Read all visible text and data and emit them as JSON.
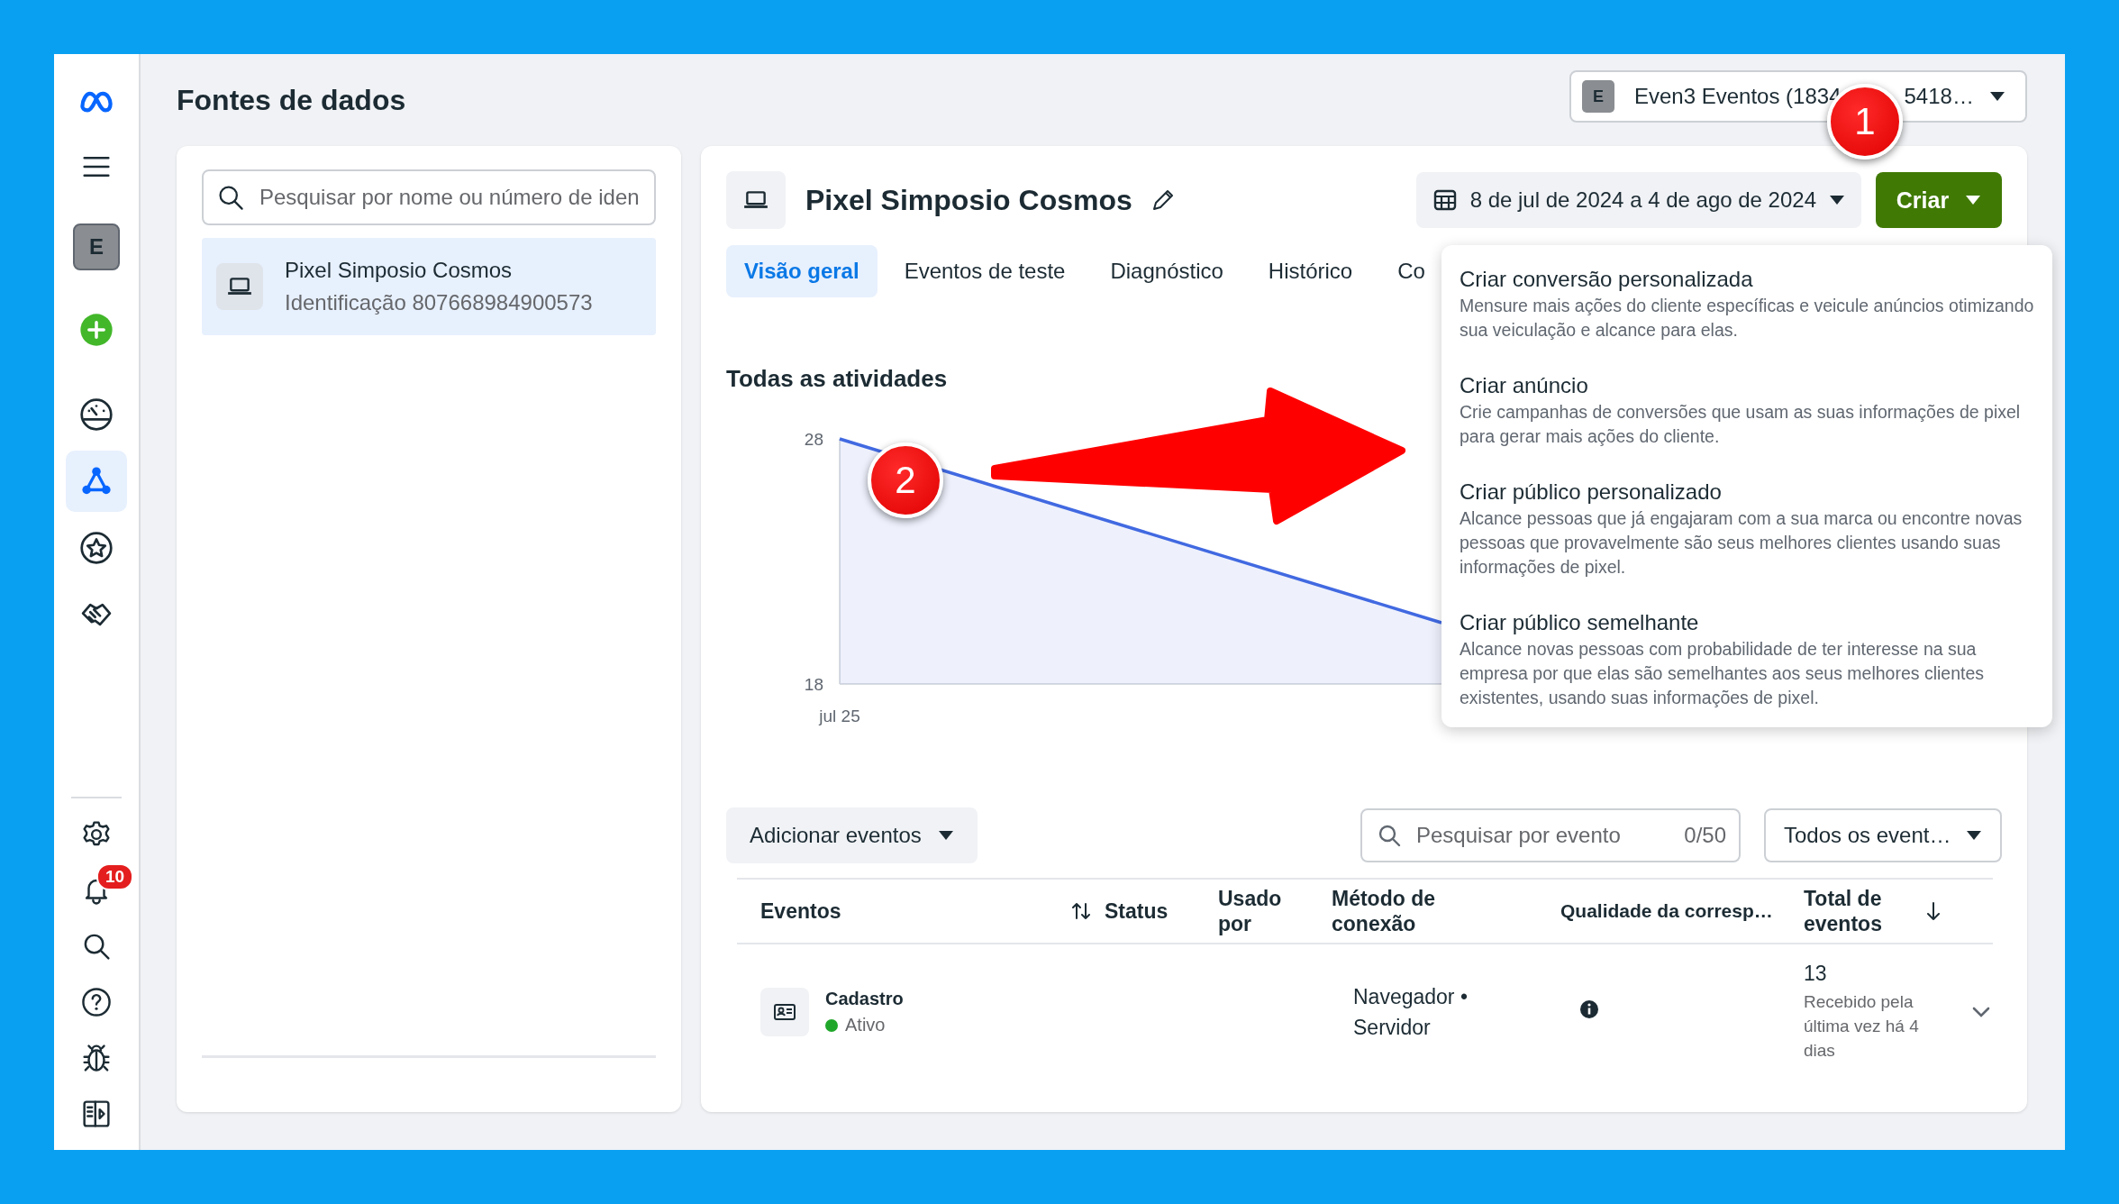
{
  "nav": {
    "top": [
      {
        "kind": "logo",
        "selected": false
      },
      {
        "kind": "menu",
        "selected": false
      },
      {
        "kind": "avatar",
        "label": "E",
        "selected": false
      },
      {
        "kind": "create",
        "selected": false
      },
      {
        "kind": "gauge",
        "selected": false
      },
      {
        "kind": "network",
        "selected": true
      },
      {
        "kind": "star",
        "selected": false
      },
      {
        "kind": "handshake",
        "selected": false
      }
    ],
    "bottom": [
      {
        "kind": "settings"
      },
      {
        "kind": "bell",
        "badge": "10"
      },
      {
        "kind": "search"
      },
      {
        "kind": "help"
      },
      {
        "kind": "bug"
      },
      {
        "kind": "panel"
      }
    ]
  },
  "page_title": "Fontes de dados",
  "account": {
    "avatar": "E",
    "name_start": "Even3 Eventos (1834",
    "name_end": "5418…"
  },
  "sources": {
    "search": {
      "placeholder": "Pesquisar por nome ou número de iden"
    },
    "items": [
      {
        "name": "Pixel Simposio Cosmos",
        "id": "Identificação 807668984900573",
        "selected": true
      }
    ]
  },
  "pixel": {
    "title": "Pixel Simposio Cosmos",
    "date_range": "8 de jul de 2024 a 4 de ago de 2024",
    "create_button": "Criar",
    "tabs": [
      {
        "label": "Visão geral",
        "selected": true
      },
      {
        "label": "Eventos de teste",
        "selected": false
      },
      {
        "label": "Diagnóstico",
        "selected": false
      },
      {
        "label": "Histórico",
        "selected": false
      },
      {
        "label": "Co",
        "selected": false
      }
    ],
    "activity": {
      "chart_data": {
        "type": "area",
        "title": "Todas as atividades",
        "ylim": [
          18,
          28
        ],
        "yticks": [
          {
            "value": 18,
            "label": "18"
          },
          {
            "value": 28,
            "label": "28"
          }
        ],
        "annotations": [
          {
            "text": "jul 25"
          }
        ],
        "series": [
          {
            "color": "#4169e1",
            "values": [
              28,
              20.5
            ]
          }
        ]
      }
    },
    "toolbar": {
      "add_events": "Adicionar eventos",
      "search": {
        "placeholder": "Pesquisar por evento",
        "counter": "0/50"
      },
      "filter": "Todos os event…"
    },
    "table": {
      "columns": [
        {
          "label": "Eventos",
          "sortable": true
        },
        {
          "label": "Status"
        },
        {
          "label": "Usado por"
        },
        {
          "label": "Método de conexão"
        },
        {
          "label": "Qualidade da corresp…"
        },
        {
          "label": "Total de eventos",
          "sorted": true
        }
      ],
      "rows": [
        {
          "name": "Cadastro",
          "status": "Ativo",
          "color": "#20a72b",
          "method": "Navegador • Servidor",
          "total": "13",
          "last_received": "Recebido pela última vez há 4 dias"
        }
      ]
    }
  },
  "create_menu": [
    {
      "title": "Criar conversão personalizada",
      "description": "Mensure mais ações do cliente específicas e veicule anúncios otimizando sua veiculação e alcance para elas."
    },
    {
      "title": "Criar anúncio",
      "description": "Crie campanhas de conversões que usam as suas informações de pixel para gerar mais ações do cliente."
    },
    {
      "title": "Criar público personalizado",
      "description": "Alcance pessoas que já engajaram com a sua marca ou encontre novas pessoas que provavelmente são seus melhores clientes usando suas informações de pixel."
    },
    {
      "title": "Criar público semelhante",
      "description": "Alcance novas pessoas com probabilidade de ter interesse na sua empresa por que elas são semelhantes aos seus melhores clientes existentes, usando suas informações de pixel."
    }
  ],
  "annotations": [
    {
      "number": "1"
    },
    {
      "number": "2"
    }
  ]
}
